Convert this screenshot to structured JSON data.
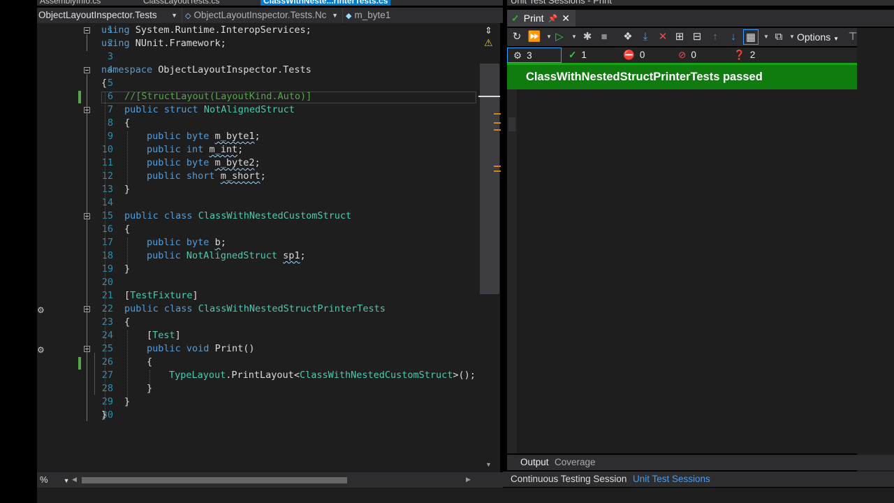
{
  "doc_tabs": [
    "AssemblyInfo.cs",
    "ClassLayoutTests.cs",
    "ClassWithNeste...rinterTests.cs"
  ],
  "nav": {
    "project": "ObjectLayoutInspector.Tests",
    "type": "ObjectLayoutInspector.Tests.Nc",
    "member": "m_byte1"
  },
  "lines": [
    {
      "n": "1"
    },
    {
      "n": "2"
    },
    {
      "n": "3"
    },
    {
      "n": "4"
    },
    {
      "n": "5"
    },
    {
      "n": "6"
    },
    {
      "n": "7"
    },
    {
      "n": "8"
    },
    {
      "n": "9"
    },
    {
      "n": "10"
    },
    {
      "n": "11"
    },
    {
      "n": "12"
    },
    {
      "n": "13"
    },
    {
      "n": "14"
    },
    {
      "n": "15"
    },
    {
      "n": "16"
    },
    {
      "n": "17"
    },
    {
      "n": "18"
    },
    {
      "n": "19"
    },
    {
      "n": "20"
    },
    {
      "n": "21"
    },
    {
      "n": "22"
    },
    {
      "n": "23"
    },
    {
      "n": "24"
    },
    {
      "n": "25"
    },
    {
      "n": "26"
    },
    {
      "n": "27"
    },
    {
      "n": "28"
    },
    {
      "n": "29"
    },
    {
      "n": "30"
    }
  ],
  "code": {
    "l1": {
      "kw": "using",
      "rest": " System.Runtime.InteropServices;"
    },
    "l2": {
      "kw": "using",
      "rest": " NUnit.Framework;"
    },
    "l4": {
      "kw": "namespace",
      "rest": " ObjectLayoutInspector.Tests"
    },
    "l5": "{",
    "l6": "//[StructLayout(LayoutKind.Auto)]",
    "l7": {
      "kw1": "public",
      "kw2": "struct",
      "ty": "NotAlignedStruct"
    },
    "l8": "{",
    "l9": {
      "kw1": "public",
      "kw2": "byte",
      "id": "m_byte1",
      "end": ";"
    },
    "l10": {
      "kw1": "public",
      "kw2": "int",
      "id": "m_int",
      "end": ";"
    },
    "l11": {
      "kw1": "public",
      "kw2": "byte",
      "id": "m_byte2",
      "end": ";"
    },
    "l12": {
      "kw1": "public",
      "kw2": "short",
      "id": "m_short",
      "end": ";"
    },
    "l13": "}",
    "l15": {
      "kw1": "public",
      "kw2": "class",
      "ty": "ClassWithNestedCustomStruct"
    },
    "l16": "{",
    "l17": {
      "kw1": "public",
      "kw2": "byte",
      "id": "b",
      "end": ";"
    },
    "l18": {
      "kw1": "public",
      "ty": "NotAlignedStruct",
      "id": "sp1",
      "end": ";"
    },
    "l19": "}",
    "l21": {
      "open": "[",
      "ty": "TestFixture",
      "close": "]"
    },
    "l22": {
      "kw1": "public",
      "kw2": "class",
      "ty": "ClassWithNestedStructPrinterTests"
    },
    "l23": "{",
    "l24": {
      "open": "[",
      "ty": "Test",
      "close": "]"
    },
    "l25": {
      "kw1": "public",
      "kw2": "void",
      "rest": " Print()"
    },
    "l26": "{",
    "l27": {
      "ty1": "TypeLayout",
      "mid": ".PrintLayout<",
      "ty2": "ClassWithNestedCustomStruct",
      "end": ">();"
    },
    "l28": "}",
    "l29": "}",
    "l30": "}"
  },
  "zoom": "%",
  "right_panel": {
    "title": "Unit Test Sessions - Print",
    "tab": "Print",
    "options_label": "Options",
    "counts": {
      "total": "3",
      "passed": "1",
      "failed": "0",
      "ignored": "0",
      "unknown": "2"
    },
    "banner": "ClassWithNestedStructPrinterTests passed",
    "bottom_tabs": [
      "Output",
      "Coverage"
    ],
    "session_tabs": [
      "Continuous Testing Session",
      "Unit Test Sessions"
    ]
  },
  "colors": {
    "keyword": "#569cd6",
    "type": "#4ec9b0",
    "comment": "#57a64a",
    "banner": "#107c10",
    "accent": "#007acc"
  }
}
